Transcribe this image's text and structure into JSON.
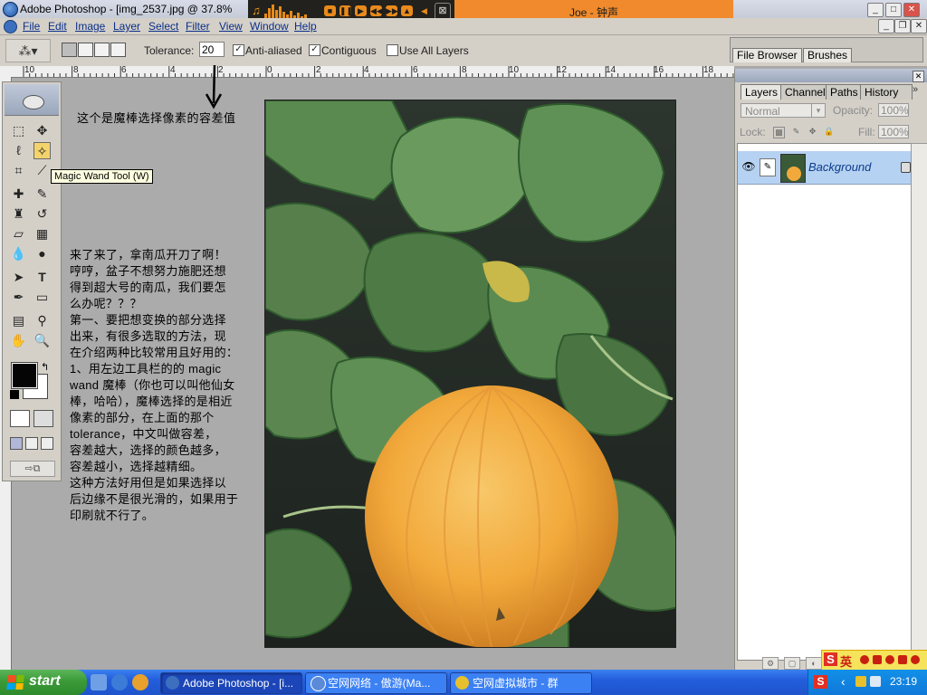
{
  "window": {
    "title": "Adobe Photoshop - [img_2537.jpg @ 37.8%",
    "controls": [
      "_",
      "□",
      "✕"
    ],
    "doc_controls": [
      "_",
      "❐",
      "✕"
    ]
  },
  "media_player": {
    "song": "Joe - 钟声",
    "buttons": [
      "■",
      "❚❚",
      "▶",
      "◀◀",
      "▶▶",
      "▲",
      "◀"
    ],
    "close_glyph": "⊠"
  },
  "menu": {
    "items": [
      "File",
      "Edit",
      "Image",
      "Layer",
      "Select",
      "Filter",
      "View",
      "Window",
      "Help"
    ]
  },
  "options_bar": {
    "tolerance_label": "Tolerance:",
    "tolerance_value": "20",
    "anti_aliased_label": "Anti-aliased",
    "anti_aliased_checked": true,
    "contiguous_label": "Contiguous",
    "contiguous_checked": true,
    "use_all_layers_label": "Use All Layers",
    "use_all_layers_checked": false,
    "check_glyph": "✓",
    "tool_preset_glyph": "⁂▾"
  },
  "palette_well": {
    "tabs": [
      "File Browser",
      "Brushes"
    ]
  },
  "ruler": {
    "labels": [
      "10",
      "8",
      "6",
      "4",
      "2",
      "0",
      "2",
      "4",
      "6",
      "8",
      "10",
      "12",
      "14",
      "16",
      "18"
    ]
  },
  "toolbox": {
    "tools": [
      {
        "name": "marquee-tool",
        "glyph": "⬚"
      },
      {
        "name": "move-tool",
        "glyph": "✥"
      },
      {
        "name": "lasso-tool",
        "glyph": "ℓ"
      },
      {
        "name": "magic-wand-tool",
        "glyph": "✧"
      },
      {
        "name": "crop-tool",
        "glyph": "⌗"
      },
      {
        "name": "slice-tool",
        "glyph": "⟋"
      },
      {
        "name": "healing-tool",
        "glyph": "✚"
      },
      {
        "name": "brush-tool",
        "glyph": "✎"
      },
      {
        "name": "clone-stamp-tool",
        "glyph": "♜"
      },
      {
        "name": "history-brush-tool",
        "glyph": "↺"
      },
      {
        "name": "eraser-tool",
        "glyph": "▱"
      },
      {
        "name": "gradient-tool",
        "glyph": "▦"
      },
      {
        "name": "blur-tool",
        "glyph": "💧"
      },
      {
        "name": "dodge-tool",
        "glyph": "●"
      },
      {
        "name": "path-select-tool",
        "glyph": "➤"
      },
      {
        "name": "type-tool",
        "glyph": "T"
      },
      {
        "name": "pen-tool",
        "glyph": "✒"
      },
      {
        "name": "shape-tool",
        "glyph": "▭"
      },
      {
        "name": "notes-tool",
        "glyph": "▤"
      },
      {
        "name": "eyedropper-tool",
        "glyph": "⚲"
      },
      {
        "name": "hand-tool",
        "glyph": "✋"
      },
      {
        "name": "zoom-tool",
        "glyph": "🔍"
      }
    ],
    "active_tool": "magic-wand-tool",
    "foreground_color": "#050505",
    "background_color": "#FFFFFF",
    "jump_glyph": "⇨⧉"
  },
  "tooltip": "Magic Wand Tool (W)",
  "annotation_top": "这个是魔棒选择像素的容差值",
  "instructions": "来了来了，拿南瓜开刀了啊！\n哼哼，盆子不想努力施肥还想\n得到超大号的南瓜，我们要怎\n么办呢？？？\n第一、要把想变换的部分选择\n出来，有很多选取的方法，现\n在介绍两种比较常用且好用的：\n1、用左边工具栏的的 magic\nwand 魔棒（你也可以叫他仙女\n棒，哈哈），魔棒选择的是相近\n像素的部分，在上面的那个\ntolerance，中文叫做容差，\n容差越大，选择的颜色越多，\n容差越小，选择越精细。\n这种方法好用但是如果选择以\n后边缘不是很光滑的，如果用于\n印刷就不行了。",
  "layers_panel": {
    "tabs": [
      "Layers",
      "Channels",
      "Paths",
      "History"
    ],
    "tabs_more": "»",
    "blend_mode": "Normal",
    "opacity_label": "Opacity:",
    "opacity_value": "100%",
    "lock_label": "Lock:",
    "fill_label": "Fill:",
    "fill_value": "100%",
    "lock_glyphs": [
      "▩",
      "✎",
      "✥",
      "🔒"
    ],
    "bottom_glyphs": [
      "⚙",
      "▢",
      "◐"
    ],
    "layer": {
      "name": "Background",
      "eye_glyph": "👁",
      "brush_glyph": "✎"
    }
  },
  "ime_bar": {
    "s": "S",
    "lang": "英"
  },
  "taskbar": {
    "start_label": "start",
    "tasks": [
      {
        "label": "Adobe Photoshop - [i...",
        "active": true
      },
      {
        "label": "空网网络 - 傲游(Ma...",
        "active": false
      },
      {
        "label": "空网虚拟城市 - 群",
        "active": false
      }
    ],
    "tray_s": "S",
    "tray_chevron": "‹",
    "clock": "23:19"
  },
  "colors": {
    "workspace": "#ABABAB",
    "pumpkin": "#F2A93B",
    "leaf": "#4E7D45",
    "song_bar": "#F08A2C",
    "selected_layer": "#B6D2F2"
  }
}
